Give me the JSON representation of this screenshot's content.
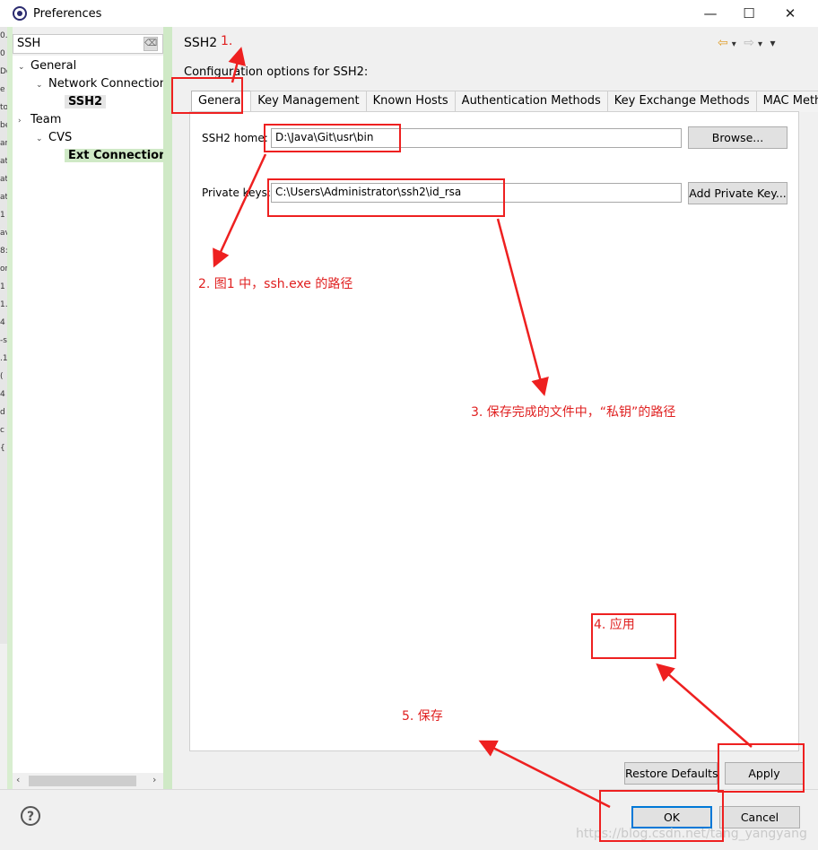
{
  "window": {
    "title": "Preferences",
    "minimize": "—",
    "maximize": "☐",
    "close": "✕"
  },
  "left_strip": "0.\n0\nDo\ne\nto\nbe\nar\nat\nat\nat\n1\nav\n8:\nor\n1\n1.\n4\n-s\n.1\n(\n4\nd\nc\n{",
  "filter": {
    "value": "SSH",
    "clear_icon": "⌫"
  },
  "tree": {
    "items": [
      {
        "label": "General",
        "arrow": "⌄"
      },
      {
        "label": "Network Connections",
        "arrow": "⌄"
      },
      {
        "label": "SSH2",
        "arrow": ""
      },
      {
        "label": "Team",
        "arrow": "›"
      },
      {
        "label": "CVS",
        "arrow": "⌄"
      },
      {
        "label": "Ext Connection M",
        "arrow": ""
      }
    ],
    "scroll_left": "‹",
    "scroll_right": "›"
  },
  "page": {
    "title": "SSH2",
    "nav_back": "⇦",
    "nav_forward": "⇨",
    "nav_menu": "▾",
    "description": "Configuration options for SSH2:",
    "tabs": [
      "General",
      "Key Management",
      "Known Hosts",
      "Authentication Methods",
      "Key Exchange Methods",
      "MAC Methods"
    ]
  },
  "general": {
    "ssh2_home_label": "SSH2 home:",
    "ssh2_home_value": "D:\\Java\\Git\\usr\\bin",
    "browse_button": "Browse...",
    "private_keys_label": "Private keys:",
    "private_keys_value": "C:\\Users\\Administrator\\ssh2\\id_rsa",
    "add_private_key_button": "Add Private Key..."
  },
  "buttons": {
    "restore_defaults": "Restore Defaults",
    "apply": "Apply",
    "ok": "OK",
    "cancel": "Cancel",
    "help": "?"
  },
  "annotations": {
    "step1": "1.",
    "step2": "2. 图1 中，ssh.exe 的路径",
    "step3": "3. 保存完成的文件中，“私钥”的路径",
    "step4": "4. 应用",
    "step5": "5. 保存",
    "color": "#ee2020"
  },
  "watermark": "https://blog.csdn.net/tang_yangyang"
}
